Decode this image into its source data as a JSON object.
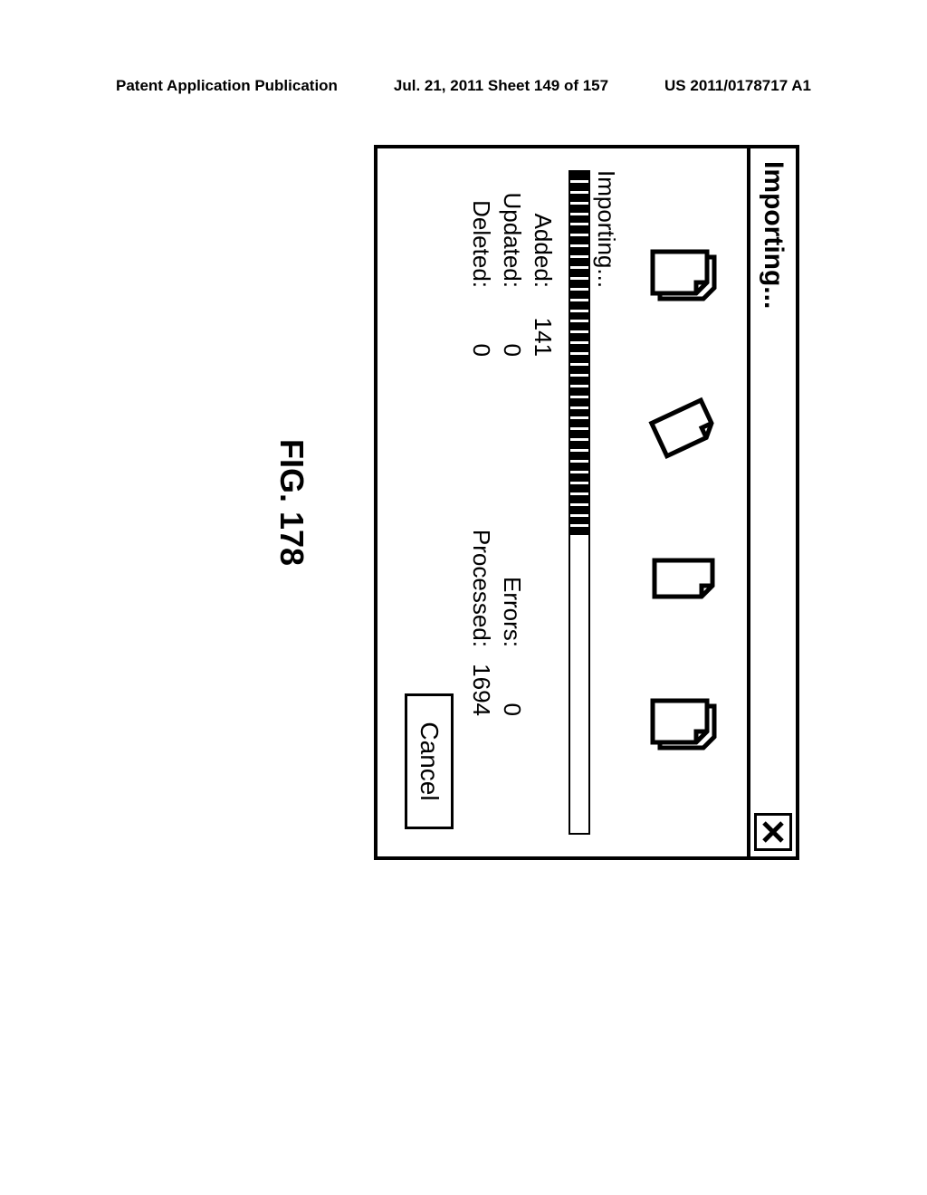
{
  "header": {
    "left": "Patent Application Publication",
    "center": "Jul. 21, 2011  Sheet 149 of 157",
    "right": "US 2011/0178717 A1"
  },
  "dialog": {
    "title": "Importing...",
    "status_label": "Importing...",
    "progress_percent": 55,
    "stats_left": {
      "added_label": "Added:",
      "added_value": "141",
      "updated_label": "Updated:",
      "updated_value": "0",
      "deleted_label": "Deleted:",
      "deleted_value": "0"
    },
    "stats_right": {
      "errors_label": "Errors:",
      "errors_value": "0",
      "processed_label": "Processed:",
      "processed_value": "1694"
    },
    "cancel_label": "Cancel"
  },
  "figure_label": "FIG. 178"
}
